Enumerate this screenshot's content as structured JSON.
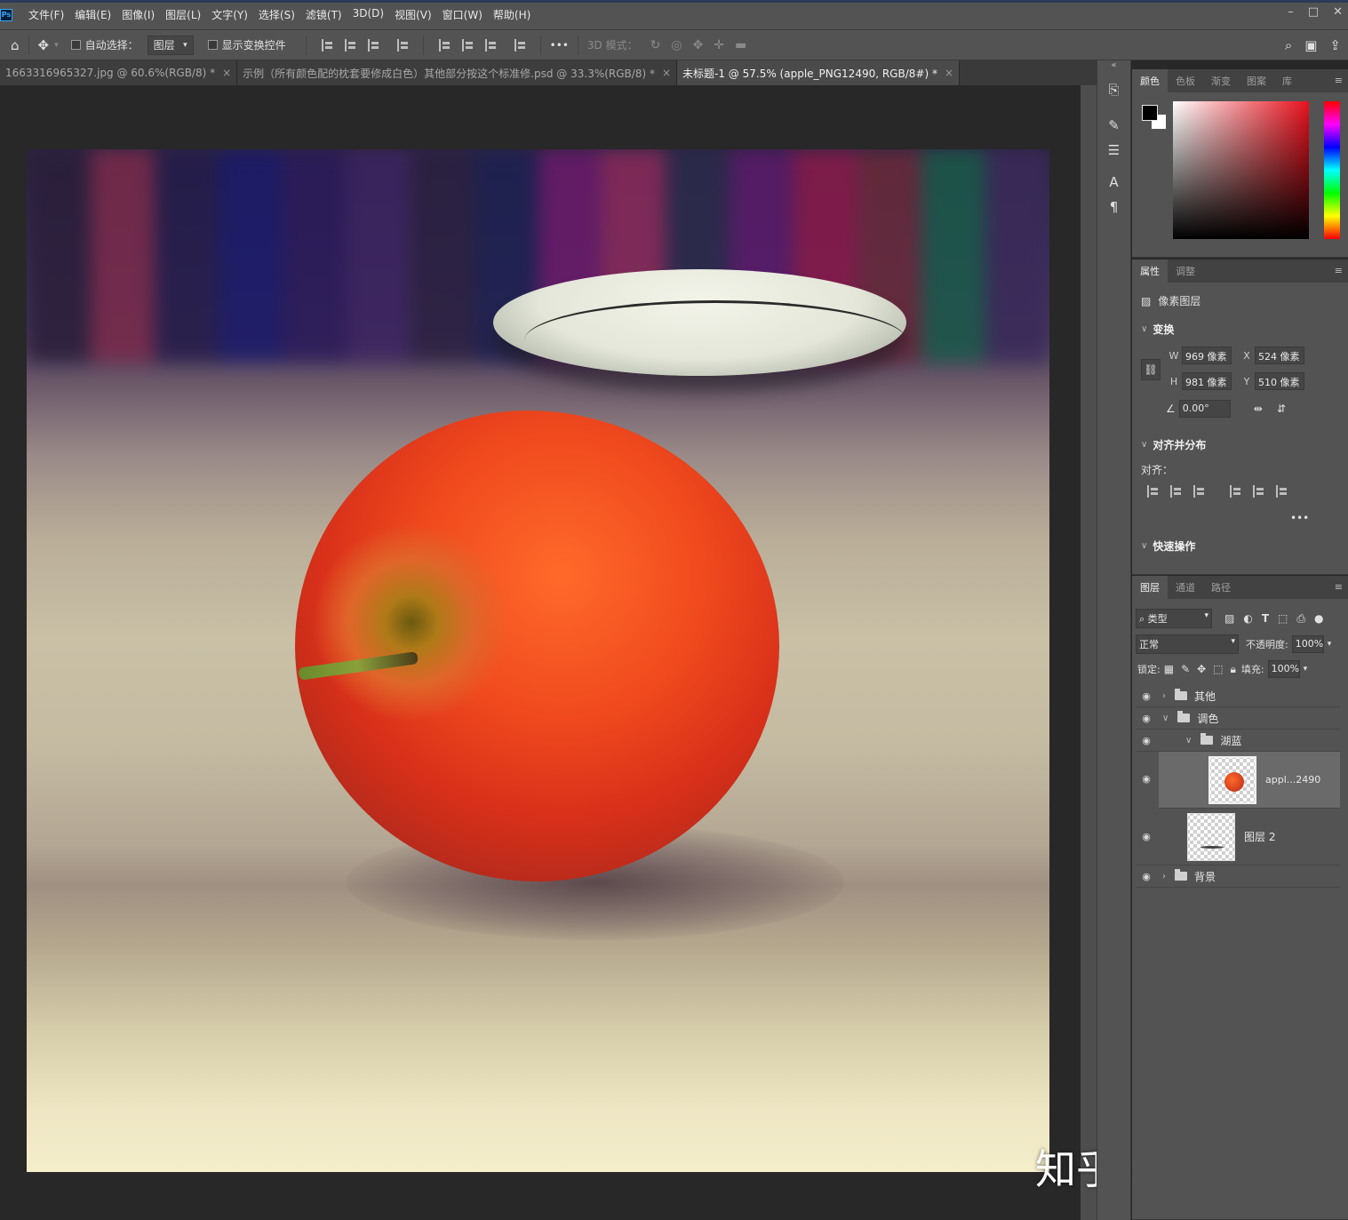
{
  "app": {
    "logo_text": "Ps",
    "menu": [
      "文件(F)",
      "编辑(E)",
      "图像(I)",
      "图层(L)",
      "文字(Y)",
      "选择(S)",
      "滤镜(T)",
      "3D(D)",
      "视图(V)",
      "窗口(W)",
      "帮助(H)"
    ],
    "window_controls": {
      "minimize": "–",
      "restore": "□",
      "close": "✕"
    }
  },
  "options_bar": {
    "auto_select_label": "自动选择：",
    "auto_select_target": "图层",
    "show_transform_label": "显示变换控件",
    "mode_3d_label": "3D 模式：",
    "more": "•••"
  },
  "tabs": [
    {
      "label": "1663316965327.jpg @ 60.6%(RGB/8) *",
      "close": "×"
    },
    {
      "label": "示例（所有颜色配的枕套要修成白色）其他部分按这个标准修.psd @ 33.3%(RGB/8) *",
      "close": "×"
    },
    {
      "label": "未标题-1 @ 57.5% (apple_PNG12490, RGB/8#) *",
      "close": "×"
    }
  ],
  "watermark": "知乎 @阿七Pro",
  "color_panel": {
    "tabs": [
      "颜色",
      "色板",
      "渐变",
      "图案",
      "库"
    ],
    "foreground": "#000000",
    "background": "#ffffff"
  },
  "properties_panel": {
    "tabs": [
      "属性",
      "调整"
    ],
    "layer_type": "像素图层",
    "transform": {
      "title": "变换",
      "w_label": "W",
      "w": "969 像素",
      "x_label": "X",
      "x": "524 像素",
      "h_label": "H",
      "h": "981 像素",
      "y_label": "Y",
      "y": "510 像素",
      "angle": "0.00°"
    },
    "align": {
      "title": "对齐并分布",
      "label": "对齐：",
      "more": "•••"
    },
    "quick_actions": {
      "title": "快速操作"
    }
  },
  "layers_panel": {
    "tabs": [
      "图层",
      "通道",
      "路径"
    ],
    "filter_kind": "类型",
    "blend_mode": "正常",
    "opacity_label": "不透明度:",
    "opacity": "100%",
    "lock_label": "锁定:",
    "fill_label": "填充:",
    "fill": "100%",
    "layers": [
      {
        "name": "其他",
        "type": "group"
      },
      {
        "name": "调色",
        "type": "group"
      },
      {
        "name": "湖蓝",
        "type": "group"
      },
      {
        "name": "appl...2490",
        "type": "pixel"
      },
      {
        "name": "图层 2",
        "type": "pixel"
      },
      {
        "name": "背景",
        "type": "group"
      }
    ]
  }
}
